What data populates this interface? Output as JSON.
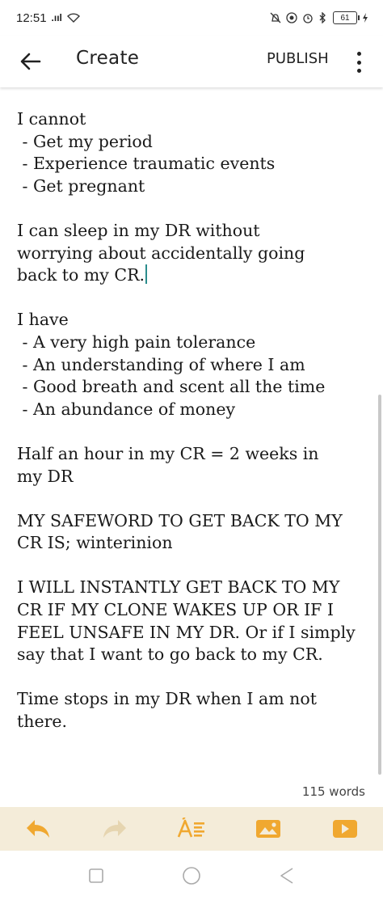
{
  "status_bar": {
    "time": "12:51",
    "signal": ".ııl",
    "icons": [
      "alarm-off-icon",
      "vpn-icon",
      "alarm-icon",
      "bluetooth-icon"
    ],
    "battery": "61"
  },
  "app_bar": {
    "title": "Create",
    "publish_label": "PUBLISH"
  },
  "editor": {
    "lines": [
      [
        "I cannot",
        " - Get my period",
        " - Experience traumatic events",
        " - Get pregnant"
      ],
      [
        "I can sleep in my DR without",
        "worrying about accidentally going",
        "back to my CR."
      ],
      [
        "I have",
        " - A very high pain tolerance",
        " - An understanding of where I am",
        " - Good breath and scent all the time",
        " - An abundance of money"
      ],
      [
        "Half an hour in my CR = 2 weeks in",
        "my DR"
      ],
      [
        "MY SAFEWORD TO GET BACK TO MY",
        "CR IS; winterinion"
      ],
      [
        "I WILL INSTANTLY GET BACK TO MY",
        "CR IF MY CLONE WAKES UP OR IF I",
        "FEEL UNSAFE IN MY DR. Or if I simply",
        "say that I want to go back to my CR."
      ],
      [
        "Time stops in my DR when I am not",
        "there."
      ]
    ]
  },
  "word_count": "115 words",
  "toolbar": {
    "accent": "#f0a830",
    "disabled": "#e6d5b0",
    "tools": [
      "undo-icon",
      "redo-icon",
      "text-format-icon",
      "image-icon",
      "video-icon"
    ]
  }
}
